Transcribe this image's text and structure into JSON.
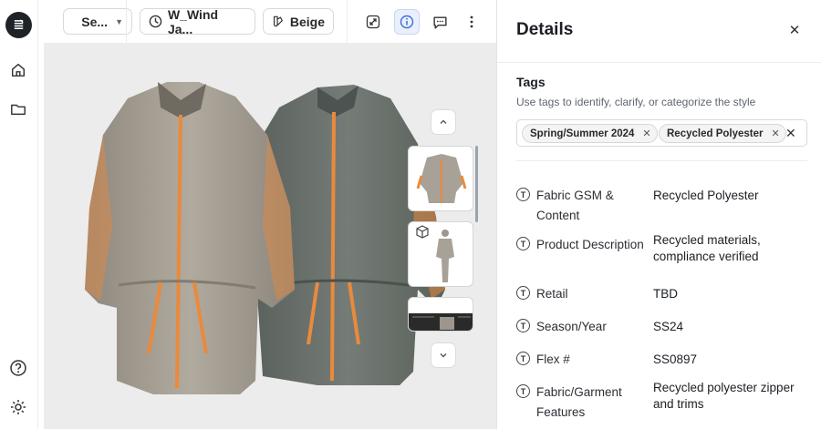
{
  "toolbar": {
    "view_select_label": "Se...",
    "style_name": "W_Wind Ja...",
    "colorway": "Beige"
  },
  "details": {
    "title": "Details",
    "tags_heading": "Tags",
    "tags_description": "Use tags to identify, clarify, or categorize the style",
    "tags": [
      "Spring/Summer 2024",
      "Recycled Polyester"
    ],
    "fields": [
      {
        "icon": "T",
        "label": "Fabric GSM & Content",
        "value": "Recycled Polyester"
      },
      {
        "icon": "T",
        "label": "Product Description",
        "value": "Recycled materials, compliance verified"
      },
      {
        "icon": "T",
        "label": "Retail",
        "value": "TBD"
      },
      {
        "icon": "T",
        "label": "Season/Year",
        "value": "SS24"
      },
      {
        "icon": "T",
        "label": "Flex #",
        "value": "SS0897"
      },
      {
        "icon": "T",
        "label": "Fabric/Garment Features",
        "value": "Recycled polyester zipper and trims"
      }
    ]
  },
  "colors": {
    "beige_jacket": "#a8a197",
    "gray_jacket": "#6e7570",
    "accent_orange": "#e98a3c",
    "active_blue": "#3b6fd6"
  }
}
